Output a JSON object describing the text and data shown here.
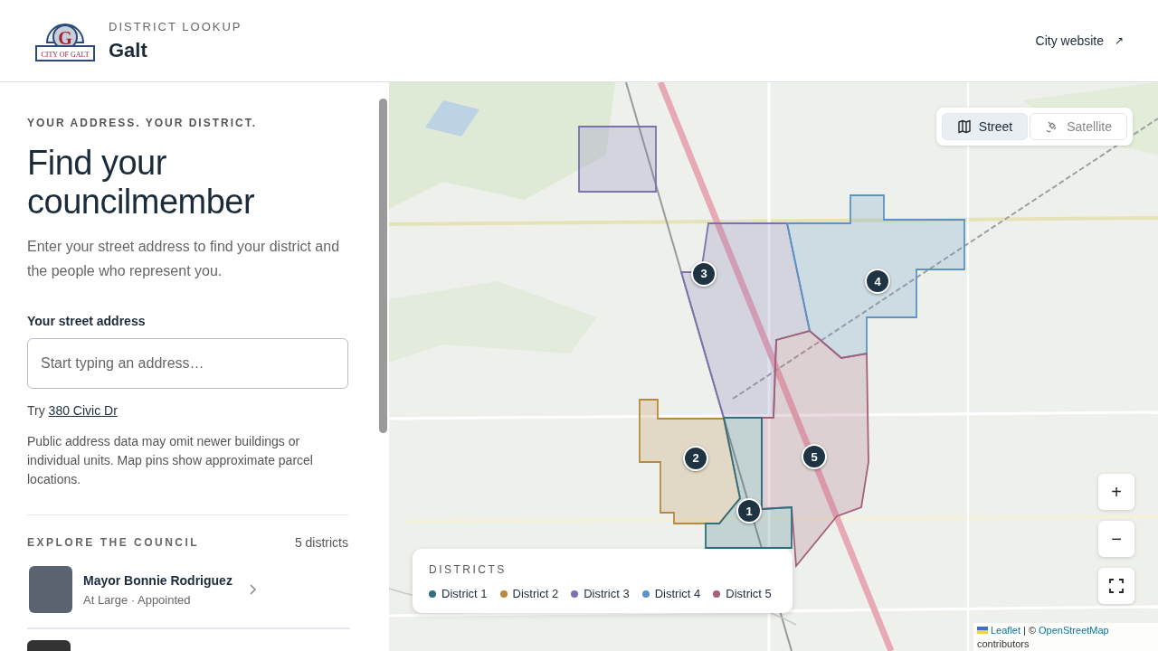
{
  "header": {
    "eyebrow": "DISTRICT LOOKUP",
    "title": "Galt",
    "logo": {
      "initial": "G",
      "banner": "CITY OF GALT"
    },
    "link": "City website",
    "link_icon": "↗"
  },
  "sidebar": {
    "eyebrow": "YOUR ADDRESS. YOUR DISTRICT.",
    "heading": "Find your councilmember",
    "intro": "Enter your street address to find your district and the people who represent you.",
    "field_label": "Your street address",
    "placeholder": "Start typing an address…",
    "try_label": "Try",
    "try_link": "380 Civic Dr",
    "note": "Public address data may omit newer buildings or individual units. Map pins show approximate parcel locations.",
    "council_heading": "EXPLORE THE COUNCIL",
    "council_count": "5 districts",
    "members": [
      {
        "name": "Mayor Bonnie Rodriguez",
        "detail": "At Large · Appointed"
      }
    ]
  },
  "map": {
    "layers": [
      {
        "label": "Street",
        "kind": "street",
        "selected": true
      },
      {
        "label": "Satellite",
        "kind": "satellite",
        "selected": false
      }
    ],
    "pins": [
      "1",
      "2",
      "3",
      "4",
      "5"
    ],
    "legend": {
      "title": "DISTRICTS",
      "items": [
        {
          "label": "District 1",
          "color": "#2f6f7e"
        },
        {
          "label": "District 2",
          "color": "#b8893a"
        },
        {
          "label": "District 3",
          "color": "#7a72b0"
        },
        {
          "label": "District 4",
          "color": "#5b93c4"
        },
        {
          "label": "District 5",
          "color": "#a5607a"
        }
      ]
    },
    "zoom_in": "+",
    "zoom_out": "−",
    "attribution": {
      "leaflet": "Leaflet",
      "separator": "| ©",
      "osm": "OpenStreetMap",
      "rest": "contributors"
    }
  }
}
